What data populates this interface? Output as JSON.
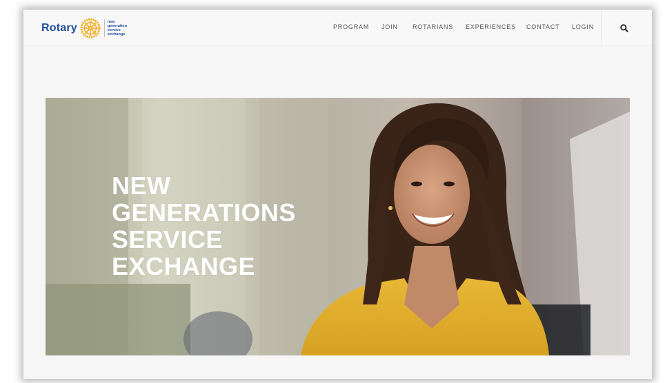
{
  "brand": {
    "name": "Rotary",
    "tagline": [
      "new",
      "generation",
      "service",
      "exchange"
    ],
    "color": "#1f4e9b",
    "wheel_color": "#f7a81b"
  },
  "nav": {
    "items": [
      {
        "label": "PROGRAM"
      },
      {
        "label": "JOIN"
      },
      {
        "label": "ROTARIANS"
      },
      {
        "label": "EXPERIENCES"
      },
      {
        "label": "CONTACT"
      },
      {
        "label": "LOGIN"
      }
    ],
    "search_icon": "search-icon"
  },
  "hero": {
    "title_lines": [
      "NEW",
      "GENERATIONS",
      "SERVICE",
      "EXCHANGE"
    ],
    "image": "smiling woman in yellow top"
  }
}
